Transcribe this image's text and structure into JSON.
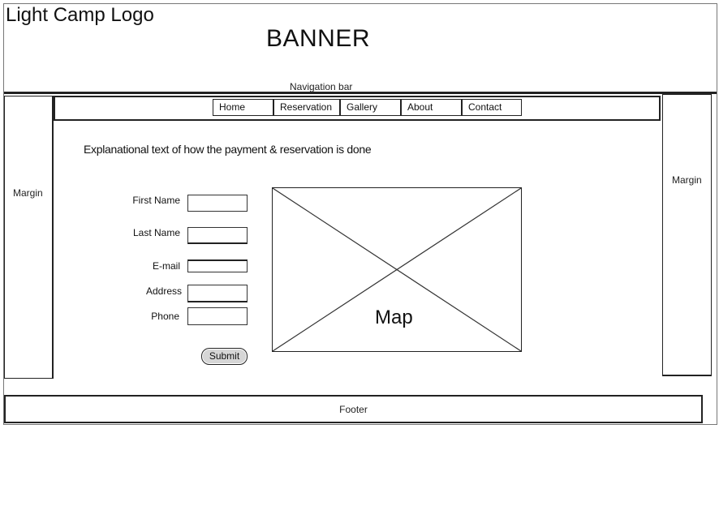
{
  "banner": {
    "logo": "Light Camp Logo",
    "title": "BANNER",
    "nav_caption": "Navigation bar"
  },
  "nav": {
    "items": [
      {
        "label": "Home"
      },
      {
        "label": "Reservation"
      },
      {
        "label": "Gallery"
      },
      {
        "label": "About"
      },
      {
        "label": "Contact"
      }
    ]
  },
  "margins": {
    "left_label": "Margin",
    "right_label": "Margin"
  },
  "main": {
    "explanation": "Explanational text of how the payment & reservation is done"
  },
  "form": {
    "first_name_label": "First Name",
    "last_name_label": "Last Name",
    "email_label": "E-mail",
    "address_label": "Address",
    "phone_label": "Phone",
    "first_name_value": "",
    "last_name_value": "",
    "email_value": "",
    "address_value": "",
    "phone_value": "",
    "submit_label": "Submit"
  },
  "map": {
    "label": "Map"
  },
  "footer": {
    "label": "Footer"
  }
}
